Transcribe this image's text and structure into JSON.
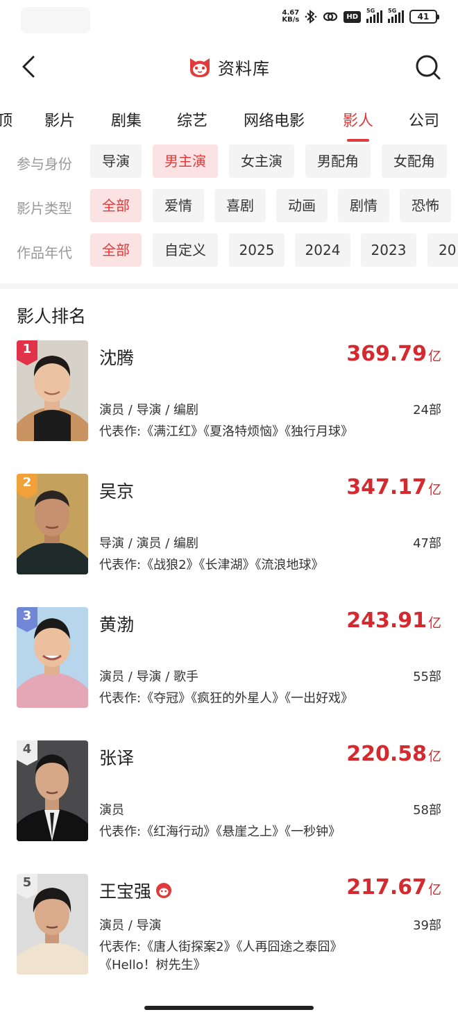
{
  "status_bar": {
    "net_speed_value": "4.67",
    "net_speed_unit": "KB/s",
    "hd_label": "HD",
    "signal1_label": "5G",
    "signal2_label": "5G",
    "battery": "41"
  },
  "header": {
    "title": "资料库"
  },
  "tabs": [
    {
      "label": "顶"
    },
    {
      "label": "影片"
    },
    {
      "label": "剧集"
    },
    {
      "label": "综艺"
    },
    {
      "label": "网络电影"
    },
    {
      "label": "影人",
      "active": true
    },
    {
      "label": "公司"
    }
  ],
  "filters": {
    "role": {
      "label": "参与身份",
      "options": [
        "导演",
        "男主演",
        "女主演",
        "男配角",
        "女配角"
      ],
      "selected": "男主演"
    },
    "genre": {
      "label": "影片类型",
      "options": [
        "全部",
        "爱情",
        "喜剧",
        "动画",
        "剧情",
        "恐怖"
      ],
      "selected": "全部"
    },
    "year": {
      "label": "作品年代",
      "options": [
        "全部",
        "自定义",
        "2025",
        "2024",
        "2023",
        "20"
      ],
      "selected": "全部"
    }
  },
  "ranking": {
    "title": "影人排名",
    "items": [
      {
        "rank": "1",
        "name": "沈腾",
        "box_office": "369.79",
        "unit": "亿",
        "roles": "演员 / 导演 / 编剧",
        "works": "24部",
        "representative": "代表作:《满江红》《夏洛特烦恼》《独行月球》",
        "badge_color": "#e0334a"
      },
      {
        "rank": "2",
        "name": "吴京",
        "box_office": "347.17",
        "unit": "亿",
        "roles": "导演 / 演员 / 编剧",
        "works": "47部",
        "representative": "代表作:《战狼2》《长津湖》《流浪地球》",
        "badge_color": "#f0a13a"
      },
      {
        "rank": "3",
        "name": "黄渤",
        "box_office": "243.91",
        "unit": "亿",
        "roles": "演员 / 导演 / 歌手",
        "works": "55部",
        "representative": "代表作:《夺冠》《疯狂的外星人》《一出好戏》",
        "badge_color": "#6f87d4"
      },
      {
        "rank": "4",
        "name": "张译",
        "box_office": "220.58",
        "unit": "亿",
        "roles": "演员",
        "works": "58部",
        "representative": "代表作:《红海行动》《悬崖之上》《一秒钟》",
        "badge_color": "#eeeeee"
      },
      {
        "rank": "5",
        "name": "王宝强",
        "box_office": "217.67",
        "unit": "亿",
        "roles": "演员 / 导演",
        "works": "39部",
        "representative": "代表作:《唐人街探案2》《人再囧途之泰囧》",
        "representative_line2": "《Hello！树先生》",
        "badge_color": "#eeeeee"
      }
    ]
  },
  "colors": {
    "accent": "#e03a3a",
    "box_office": "#d42a2f",
    "chip_active_bg": "#fbe3e3"
  }
}
